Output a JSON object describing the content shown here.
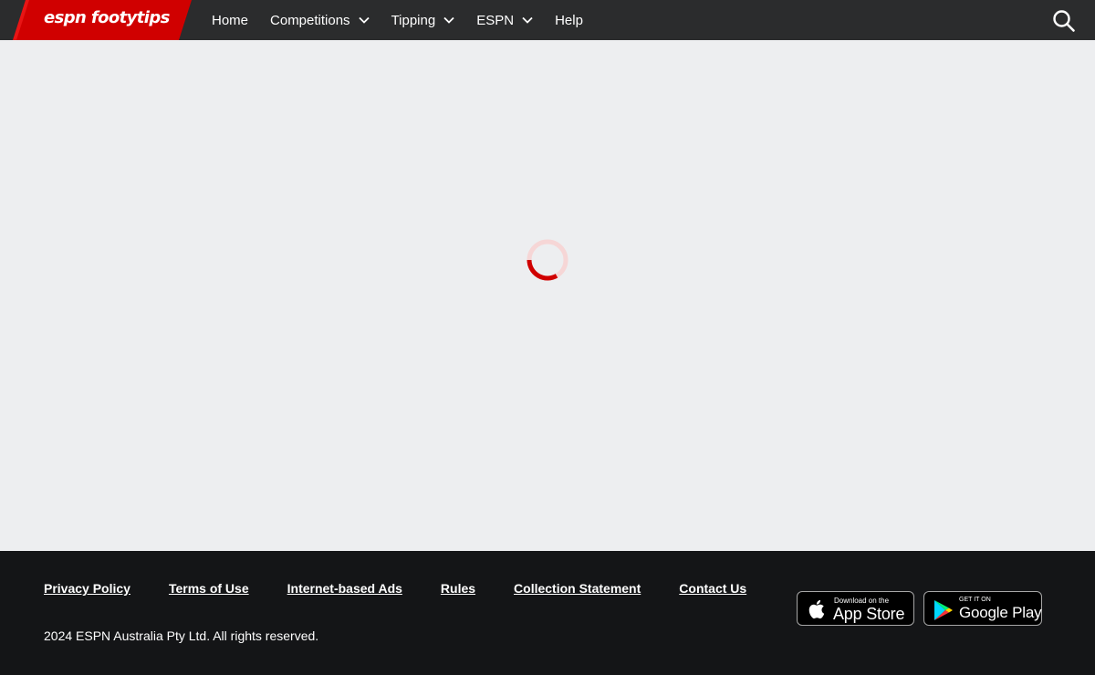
{
  "brand": {
    "logo_text": "espn footytips",
    "accent_color": "#d00000"
  },
  "nav": {
    "items": [
      {
        "label": "Home",
        "has_dropdown": false
      },
      {
        "label": "Competitions",
        "has_dropdown": true
      },
      {
        "label": "Tipping",
        "has_dropdown": true
      },
      {
        "label": "ESPN",
        "has_dropdown": true
      },
      {
        "label": "Help",
        "has_dropdown": false
      }
    ],
    "search_icon": "search-icon"
  },
  "main": {
    "state": "loading",
    "spinner_icon": "loading-spinner-icon"
  },
  "footer": {
    "links": [
      "Privacy Policy",
      "Terms of Use",
      "Internet-based Ads",
      "Rules",
      "Collection Statement",
      "Contact Us"
    ],
    "copyright": "2024 ESPN Australia Pty Ltd. All rights reserved.",
    "app_store": {
      "small": "Download on the",
      "big": "App Store"
    },
    "google_play": {
      "small": "GET IT ON",
      "big": "Google Play"
    }
  }
}
